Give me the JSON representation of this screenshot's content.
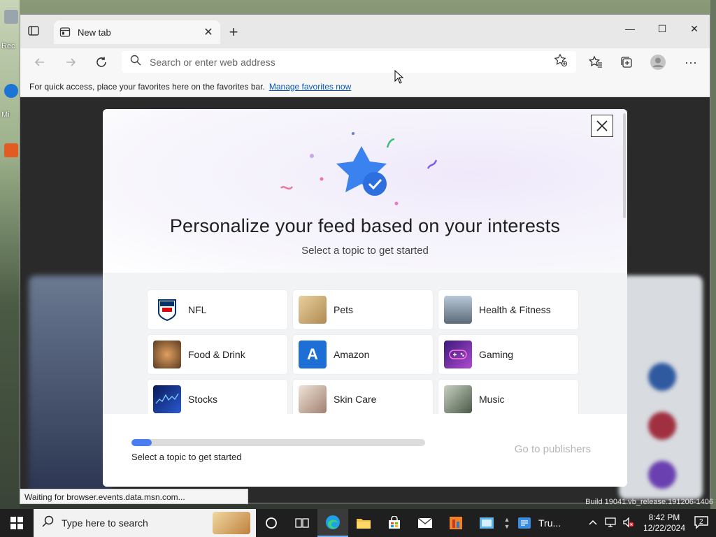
{
  "desktop": {
    "icons": [
      {
        "label": "Rec",
        "color": "#9aa4ad"
      },
      {
        "label": "Mi",
        "color": "#1c74d4"
      },
      {
        "label": "",
        "color": "#e25b22"
      }
    ]
  },
  "browser": {
    "tab": {
      "title": "New tab",
      "close_glyph": "✕"
    },
    "new_tab_glyph": "+",
    "window_controls": {
      "minimize": "—",
      "maximize": "☐",
      "close": "✕"
    },
    "address": {
      "placeholder": "Search or enter web address",
      "value": ""
    },
    "favorites_bar": {
      "text": "For quick access, place your favorites here on the favorites bar.",
      "link": "Manage favorites now"
    }
  },
  "modal": {
    "close_glyph": "✕",
    "title": "Personalize your feed based on your interests",
    "subtitle": "Select a topic to get started",
    "topics": [
      {
        "label": "NFL",
        "color": "#ffffff",
        "icon": "nfl-shield-icon"
      },
      {
        "label": "Pets",
        "color": "#c9a46b",
        "icon": "pets-photo"
      },
      {
        "label": "Health & Fitness",
        "color": "#8aa0b8",
        "icon": "fitness-photo"
      },
      {
        "label": "Food & Drink",
        "color": "#7a5a3a",
        "icon": "food-photo"
      },
      {
        "label": "Amazon",
        "color": "#1d6fd6",
        "icon": "amazon-a-icon",
        "glyph": "A"
      },
      {
        "label": "Gaming",
        "color": "#7a3fd0",
        "icon": "gamepad-icon"
      },
      {
        "label": "Stocks",
        "color": "#1a3a8a",
        "icon": "stocks-chart-photo"
      },
      {
        "label": "Skin Care",
        "color": "#d8c2b0",
        "icon": "skincare-photo"
      },
      {
        "label": "Music",
        "color": "#6b8060",
        "icon": "music-photo"
      }
    ],
    "progress": {
      "fraction": 0.07,
      "label": "Select a topic to get started"
    },
    "go_button": "Go to publishers"
  },
  "status_bar": "Waiting for browser.events.data.msn.com...",
  "build_text": "Build 19041.vb_release.191206-1406",
  "taskbar": {
    "search_placeholder": "Type here to search",
    "pinned_app_label": "Tru...",
    "time": "8:42 PM",
    "date": "12/22/2024",
    "notification_count": "2"
  }
}
